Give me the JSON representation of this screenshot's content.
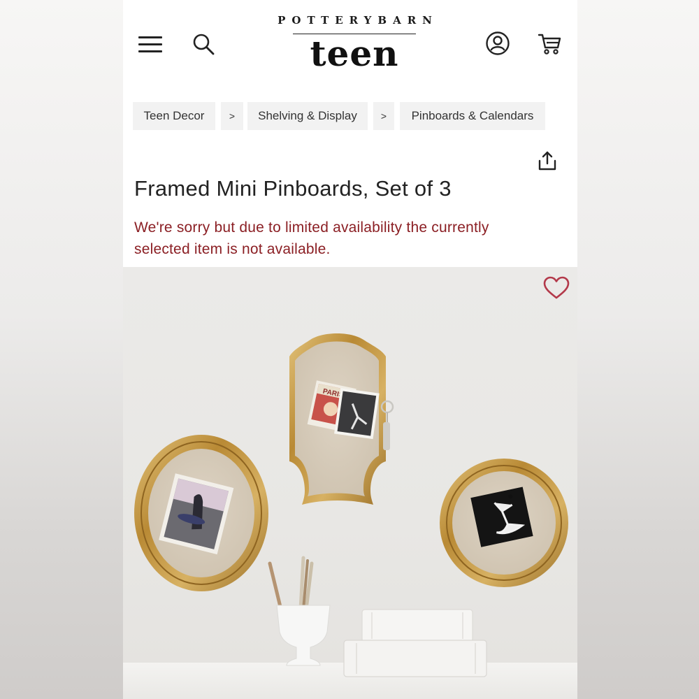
{
  "brand": {
    "top_line": "POTTERYBARN",
    "main": "teen"
  },
  "header": {
    "menu_icon": "hamburger-menu-icon",
    "search_icon": "search-icon",
    "account_icon": "account-icon",
    "cart_icon": "cart-icon"
  },
  "breadcrumb": {
    "items": [
      {
        "label": "Teen Decor"
      },
      {
        "label": "Shelving & Display"
      },
      {
        "label": "Pinboards & Calendars"
      }
    ],
    "separator": ">"
  },
  "product": {
    "title": "Framed Mini Pinboards, Set of 3",
    "availability_notice": "We're sorry but due to limited availability the currently selected item is not available.",
    "share_icon": "share-icon",
    "favorite_icon": "heart-icon"
  },
  "photo": {
    "poster_text": "PARIS"
  },
  "colors": {
    "notice": "#8b1f24",
    "favorite": "#b3394a",
    "breadcrumb_bg": "#f2f2f2",
    "frame_gold": "#c49a45"
  }
}
